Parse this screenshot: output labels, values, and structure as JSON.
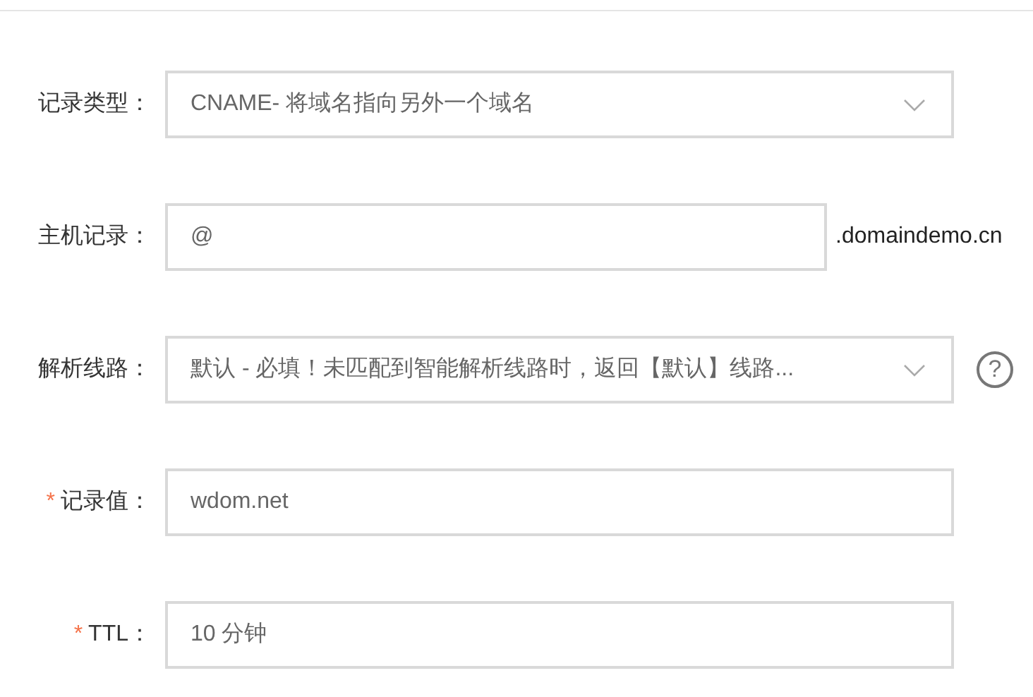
{
  "form": {
    "rows": [
      {
        "label": "记录类型：",
        "required": false,
        "kind": "select",
        "value": "CNAME- 将域名指向另外一个域名"
      },
      {
        "label": "主机记录：",
        "required": false,
        "kind": "input",
        "value": "@",
        "suffix": ".domaindemo.cn"
      },
      {
        "label": "解析线路：",
        "required": false,
        "kind": "select",
        "value": "默认 - 必填！未匹配到智能解析线路时，返回【默认】线路...",
        "help": "?"
      },
      {
        "label": "记录值：",
        "required": true,
        "kind": "input",
        "value": "wdom.net"
      },
      {
        "label": "TTL：",
        "required": true,
        "kind": "input",
        "value": "10 分钟"
      }
    ],
    "required_mark": "*"
  }
}
